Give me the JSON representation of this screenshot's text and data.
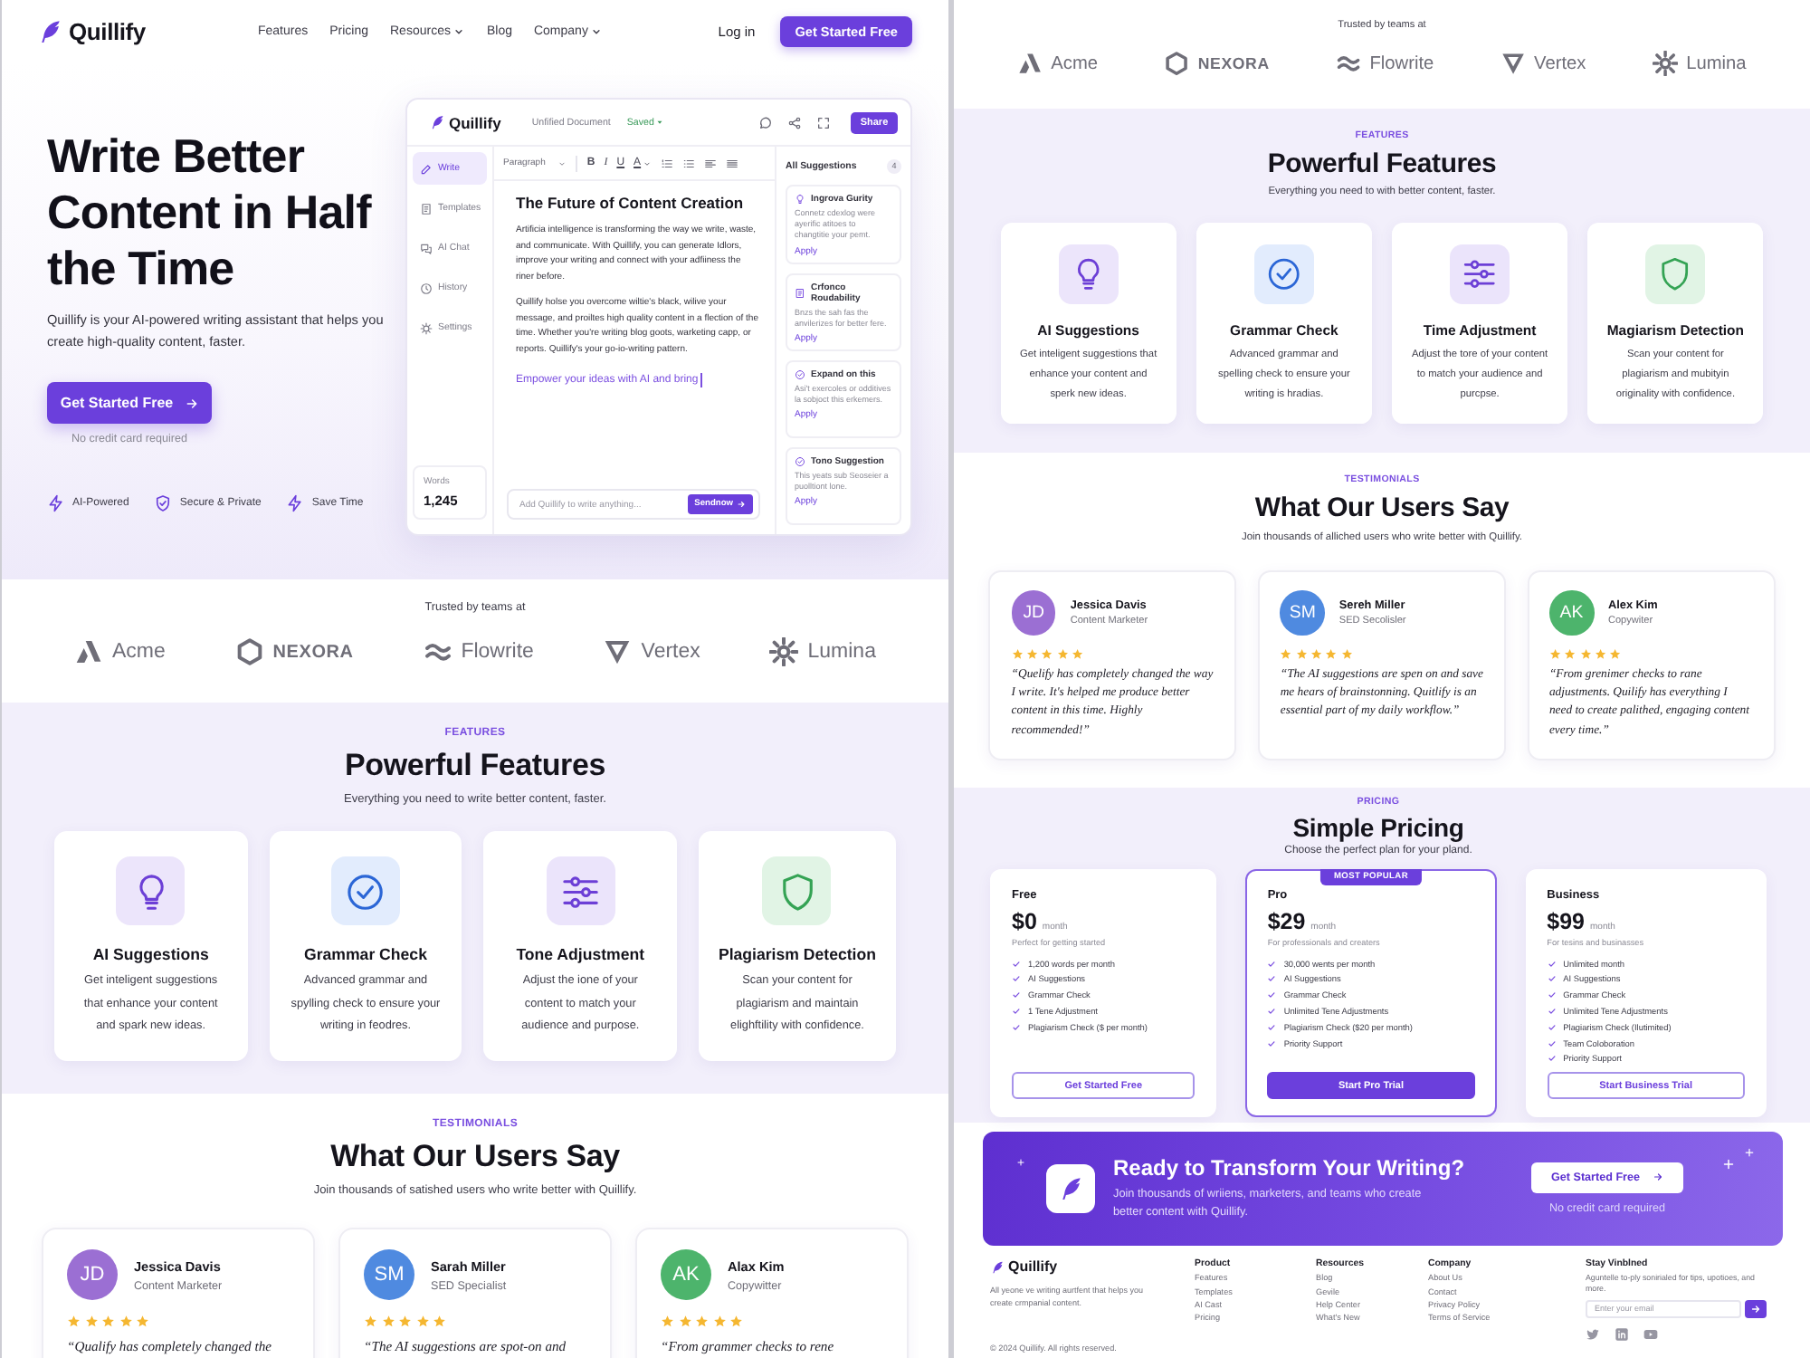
{
  "pages": [
    {
      "nav": {
        "logo": "Quillify",
        "links": [
          {
            "label": "Features",
            "dropdown": false
          },
          {
            "label": "Pricing",
            "dropdown": false
          },
          {
            "label": "Resources",
            "dropdown": true
          },
          {
            "label": "Blog",
            "dropdown": false
          },
          {
            "label": "Company",
            "dropdown": true
          }
        ],
        "login": "Log in",
        "cta": "Get Started Free"
      },
      "hero": {
        "title": "Write Better Content in Half the Time",
        "description": "Quillify is your AI-powered writing assistant that helps you create high-quality content, faster.",
        "cta": "Get Started Free",
        "note": "No credit card required",
        "badges": [
          "AI-Powered",
          "Secure & Private",
          "Save Time"
        ],
        "editor": {
          "logo": "Quillify",
          "doc_name": "Unfified Document",
          "status": "Saved",
          "share": "Share",
          "sidebar": [
            {
              "label": "Write",
              "selected": true
            },
            {
              "label": "Templates",
              "selected": false
            },
            {
              "label": "AI Chat",
              "selected": false
            },
            {
              "label": "History",
              "selected": false
            },
            {
              "label": "Settings",
              "selected": false
            }
          ],
          "word_count": {
            "label": "Words",
            "value": "1,245"
          },
          "toolbar": {
            "style": "Paragraph",
            "buttons": [
              "B",
              "I",
              "U",
              "A"
            ]
          },
          "doc_title": "The Future of Content Creation",
          "paragraphs": [
            "Artificia intelligence is transforming the way we write, waste, and communicate. With Quillify, you can generate Idlors, improve your writing and connect with your adfiiness the riner before.",
            "Quillify holse you overcome wiltie's black, wilive your message, and proiltes high quality content in a flection of the time. Whether you're writing blog goots, warketing capp, or reports. Quillify's your go-io-writing pattern."
          ],
          "draft": "Empower your ideas with AI and bring",
          "prompt": {
            "placeholder": "Add Quillify to write anything...",
            "button": "Sendnow"
          },
          "suggestions": {
            "title": "All Suggestions",
            "count": "4",
            "items": [
              {
                "title": "Ingrova Gurity",
                "text": "Connetz cdexlog were ayerific atitoes to changtitie your pemt.",
                "action": "Apply"
              },
              {
                "title": "Crfonco Roudability",
                "text": "Bnzs the sah fas the anvilerizes for better fere.",
                "action": "Apply"
              },
              {
                "title": "Expand on this",
                "text": "Asi't exercoles or odditives la sobjoct this erkemers.",
                "action": "Apply"
              },
              {
                "title": "Tono Suggestion",
                "text": "This yeats sub Seoseier a puolltiont lone.",
                "action": "Apply"
              }
            ]
          }
        }
      },
      "trusted": {
        "label": "Trusted by teams at",
        "logos": [
          "Acme",
          "NEXORA",
          "Flowrite",
          "Vertex",
          "Lumina"
        ]
      },
      "features": {
        "eyebrow": "FEATURES",
        "title": "Powerful Features",
        "subtitle": "Everything you need to write better content, faster.",
        "cards": [
          {
            "title": "AI Suggestions",
            "description": "Get inteligent suggestions that enhance your content and spark new ideas."
          },
          {
            "title": "Grammar Check",
            "description": "Advanced grammar and spylling check to ensure your writing in feodres."
          },
          {
            "title": "Tone Adjustment",
            "description": "Adjust the ione of your content to match your audience and purpose."
          },
          {
            "title": "Plagiarism Detection",
            "description": "Scan your content for plagiarism and maintain elighftility with confidence."
          }
        ]
      },
      "testimonials": {
        "eyebrow": "TESTIMONIALS",
        "title": "What Our Users Say",
        "subtitle": "Join thousands of satished users who write better with Quillify.",
        "cards": [
          {
            "initials": "JD",
            "color": "#9b6fd3",
            "name": "Jessica Davis",
            "role": "Content Marketer",
            "stars": 5,
            "quote": "“Qualify has completely changed the"
          },
          {
            "initials": "SM",
            "color": "#4f8ae0",
            "name": "Sarah Miller",
            "role": "SED Specialist",
            "stars": 5,
            "quote": "“The AI suggestions are spot-on and"
          },
          {
            "initials": "AK",
            "color": "#4db46c",
            "name": "Alax Kim",
            "role": "Copywitter",
            "stars": 5,
            "quote": "“From grammer checks to rene"
          }
        ]
      }
    },
    {
      "trusted": {
        "label": "Trusted by teams at",
        "logos": [
          "Acme",
          "NEXORA",
          "Flowrite",
          "Vertex",
          "Lumina"
        ]
      },
      "features": {
        "eyebrow": "FEATURES",
        "title": "Powerful Features",
        "subtitle": "Everything you need to with better content, faster.",
        "cards": [
          {
            "title": "AI Suggestions",
            "description": "Get inteligent suggestions that enhance your content and sperk new ideas."
          },
          {
            "title": "Grammar Check",
            "description": "Advanced grammar and spelling check to ensure your writing is hradias."
          },
          {
            "title": "Time Adjustment",
            "description": "Adjust the tore of your content to match your audience and purcpse."
          },
          {
            "title": "Magiarism Detection",
            "description": "Scan your content for plagiarism and mubityin originality with confidence."
          }
        ]
      },
      "testimonials": {
        "eyebrow": "TESTIMONIALS",
        "title": "What Our Users Say",
        "subtitle": "Join thousands of alliched users who write better with Quillify.",
        "cards": [
          {
            "initials": "JD",
            "color": "#9b6fd3",
            "name": "Jessica Davis",
            "role": "Content Marketer",
            "stars": 5,
            "quote": "“Quelify has completely changed the way I write. It's helped me produce better content in this time. Highly recommended!”"
          },
          {
            "initials": "SM",
            "color": "#4f8ae0",
            "name": "Sereh Miller",
            "role": "SED Secolisler",
            "stars": 5,
            "quote": "“The AI suggestions are spen on and save me hears of brainstonning. Quitlify is an essential part of my daily workflow.”"
          },
          {
            "initials": "AK",
            "color": "#4db46c",
            "name": "Alex Kim",
            "role": "Copywiter",
            "stars": 5,
            "quote": "“From grenimer checks to rane adjustments. Quilify has everything I need to create palithed, engaging content every time.”"
          }
        ]
      },
      "pricing": {
        "eyebrow": "PRICING",
        "title": "Simple Pricing",
        "subtitle": "Choose the perfect plan for your pland.",
        "plans": [
          {
            "name": "Free",
            "price": "$0",
            "period": "month",
            "tagline": "Perfect for getting started",
            "features": [
              "1,200 words per month",
              "AI Suggestions",
              "Grammar Check",
              "1 Tene Adjustment",
              "Plagiarism Check ($ per month)"
            ],
            "button": "Get Started Free",
            "featured": false
          },
          {
            "name": "Pro",
            "badge": "MOST POPULAR",
            "price": "$29",
            "period": "month",
            "tagline": "For professionals and creaters",
            "features": [
              "30,000 wents per month",
              "AI Suggestions",
              "Grammar Check",
              "Unlimited Tene Adjustments",
              "Plagiarism Check ($20 per month)",
              "Priority Support"
            ],
            "button": "Start Pro Trial",
            "featured": true
          },
          {
            "name": "Business",
            "price": "$99",
            "period": "month",
            "tagline": "For tesins and businasses",
            "features": [
              "Unlimited month",
              "AI Suggestions",
              "Grammar Check",
              "Unlimited Tene Adjustments",
              "Plagiarism Check (Ilutimited)",
              "Team Coloboration",
              "Priority Support"
            ],
            "button": "Start Business Trial",
            "featured": false
          }
        ]
      },
      "cta_banner": {
        "title": "Ready to Transform Your Writing?",
        "text": "Join thousands of wriiens, marketers, and teams who create better content with Quillify.",
        "button": "Get Started Free",
        "note": "No credit card required"
      },
      "footer": {
        "logo": "Quillify",
        "tagline": "All yeone ve writing aurtfent that helps you create crmpanial content.",
        "columns": [
          {
            "heading": "Product",
            "links": [
              "Features",
              "Templates",
              "AI Cast",
              "Pricing"
            ]
          },
          {
            "heading": "Resources",
            "links": [
              "Blog",
              "Gevile",
              "Help Center",
              "What's New"
            ]
          },
          {
            "heading": "Company",
            "links": [
              "About Us",
              "Contact",
              "Privacy Policy",
              "Terms of Service"
            ]
          }
        ],
        "newsletter": {
          "heading": "Stay Vinblned",
          "text": "Aguntelle to-ply sonirialed for tips, upotioes, and more.",
          "placeholder": "Enter your email"
        },
        "copyright": "© 2024 Quillify. All rights reserved."
      }
    }
  ]
}
